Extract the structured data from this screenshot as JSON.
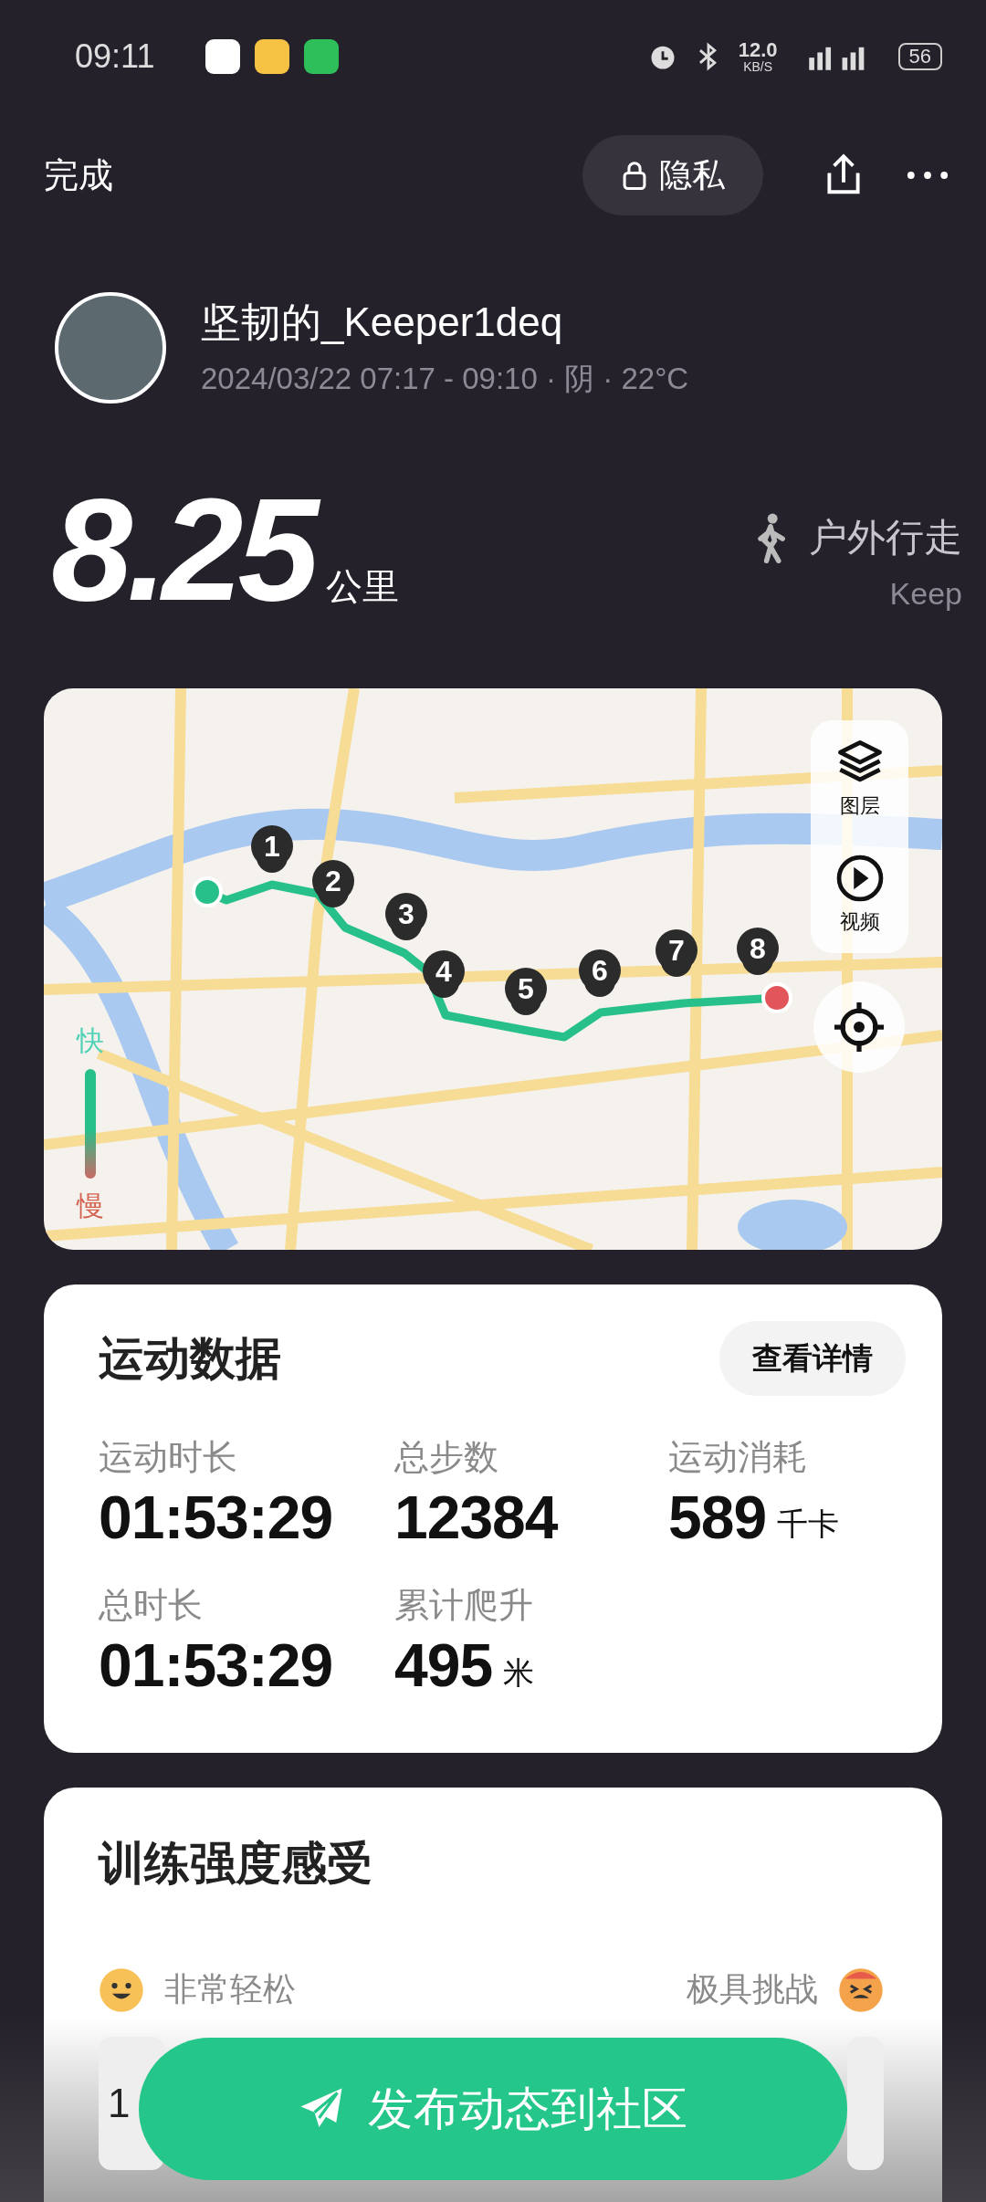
{
  "status_bar": {
    "time": "09:11",
    "net_speed": "12.0",
    "net_unit": "KB/S",
    "battery": "56"
  },
  "header": {
    "done": "完成",
    "privacy": "隐私"
  },
  "user": {
    "name": "坚韧的_Keeper1deq",
    "meta": "2024/03/22 07:17 - 09:10 · 阴 · 22°C"
  },
  "summary": {
    "distance": "8.25",
    "unit": "公里",
    "sport": "户外行走",
    "source": "Keep"
  },
  "map": {
    "markers": [
      "1",
      "2",
      "3",
      "4",
      "5",
      "6",
      "7",
      "8"
    ],
    "layers_label": "图层",
    "video_label": "视频",
    "legend_fast": "快",
    "legend_slow": "慢"
  },
  "stats": {
    "title": "运动数据",
    "details_button": "查看详情",
    "items": [
      {
        "label": "运动时长",
        "value": "01:53:29"
      },
      {
        "label": "总步数",
        "value": "12384"
      },
      {
        "label": "运动消耗",
        "value": "589",
        "unit": "千卡"
      },
      {
        "label": "总时长",
        "value": "01:53:29"
      },
      {
        "label": "累计爬升",
        "value": "495",
        "unit": "米"
      }
    ]
  },
  "intensity": {
    "title": "训练强度感受",
    "low_label": "非常轻松",
    "high_label": "极具挑战",
    "scale_first": "1"
  },
  "publish_button": "发布动态到社区"
}
